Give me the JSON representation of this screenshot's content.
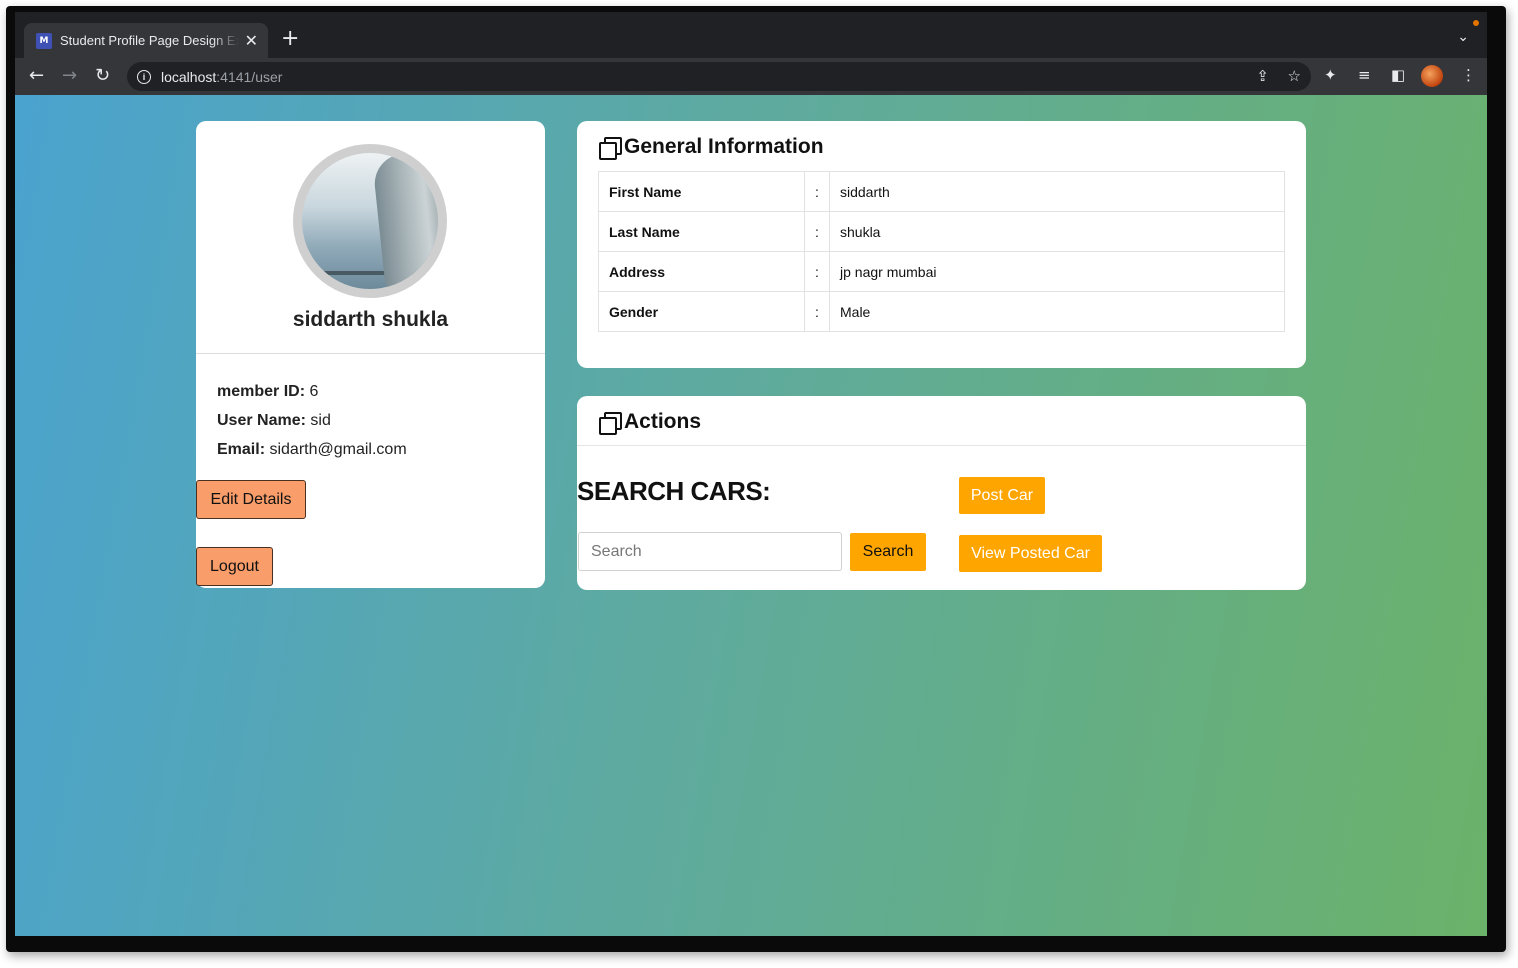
{
  "browser": {
    "tab_title": "Student Profile Page Design Ex",
    "favicon_text": "M",
    "url_host": "localhost",
    "url_rest": ":4141/user"
  },
  "profile": {
    "name": "siddarth shukla",
    "member_id_label": "member ID:",
    "member_id": "6",
    "username_label": "User Name:",
    "username": "sid",
    "email_label": "Email:",
    "email": "sidarth@gmail.com",
    "edit_label": "Edit Details",
    "logout_label": "Logout"
  },
  "general_info": {
    "title": "General Information",
    "rows": [
      {
        "label": "First Name",
        "sep": ":",
        "value": "siddarth"
      },
      {
        "label": "Last Name",
        "sep": ":",
        "value": "shukla"
      },
      {
        "label": "Address",
        "sep": ":",
        "value": "jp nagr mumbai"
      },
      {
        "label": "Gender",
        "sep": ":",
        "value": "Male"
      }
    ]
  },
  "actions": {
    "title": "Actions",
    "search_heading": "SEARCH CARS:",
    "search_placeholder": "Search",
    "search_button": "Search",
    "post_car": "Post Car",
    "view_posted_car": "View Posted Car"
  },
  "colors": {
    "accent_orange": "#f99d6a",
    "accent_amber": "#ffa500",
    "gradient_left": "#4aa3cf",
    "gradient_right": "#6bb26a"
  }
}
